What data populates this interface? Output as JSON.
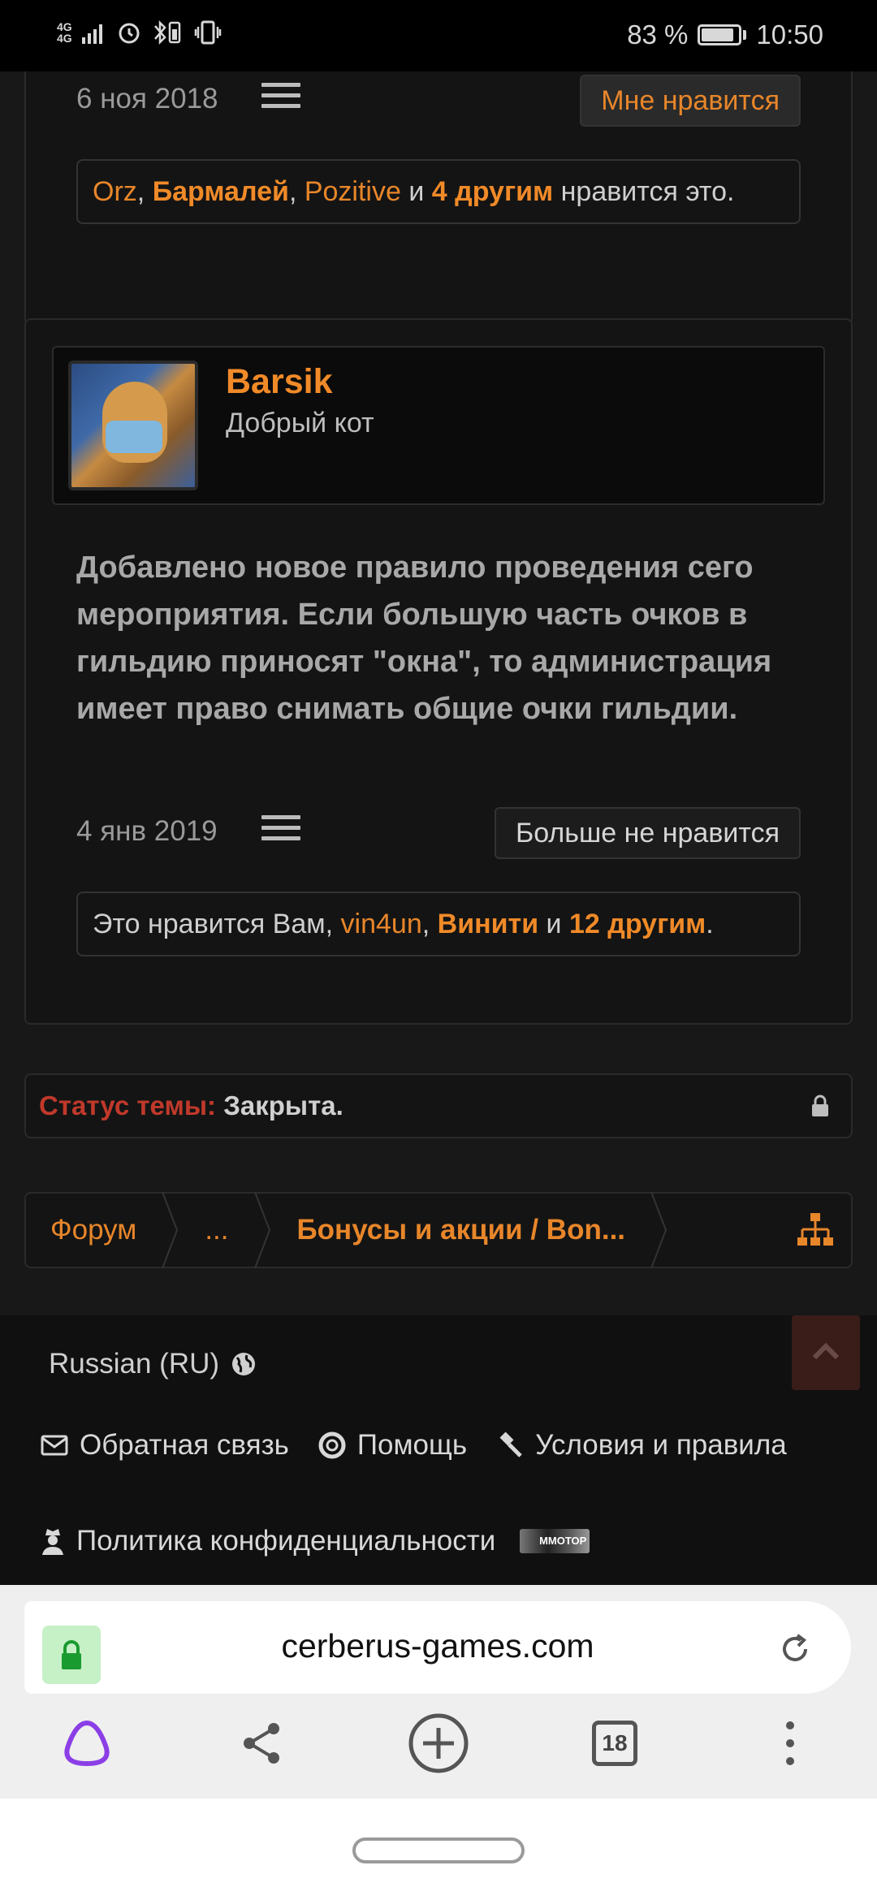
{
  "status_bar": {
    "network": "4G",
    "network_sub": "4G",
    "battery_text": "83 %",
    "battery_level": 0.83,
    "time": "10:50"
  },
  "post1": {
    "date": "6 ноя 2018",
    "like_label": "Мне нравится",
    "likes": {
      "users": [
        "Orz",
        "Бармалей",
        "Pozitive"
      ],
      "sep": ", ",
      "and": " и ",
      "others": "4 другим",
      "suffix": " нравится это."
    }
  },
  "post2": {
    "username": "Barsik",
    "user_title": "Добрый кот",
    "text": "Добавлено новое правило проведения сего мероприятия. Если большую часть очков в гильдию приносят \"окна\", то администрация имеет право снимать общие очки гильдии.",
    "date": "4 янв 2019",
    "unlike_label": "Больше не нравится",
    "likes": {
      "prefix": "Это нравится Вам, ",
      "user1": "vin4un",
      "sep": ", ",
      "user2": "Винити",
      "and": " и ",
      "others": "12 другим",
      "suffix": "."
    }
  },
  "thread_status": {
    "label": "Статус темы:",
    "value": "Закрыта."
  },
  "breadcrumb": {
    "items": [
      "Форум",
      "...",
      "Бонусы и акции / Bon..."
    ]
  },
  "footer": {
    "language": "Russian (RU)",
    "links": [
      "Обратная связь",
      "Помощь",
      "Условия и правила",
      "Политика конфиденциальности"
    ],
    "mmotop": "MMOTOP"
  },
  "browser": {
    "url": "cerberus-games.com",
    "tab_count": "18"
  },
  "colors": {
    "accent": "#e8862a",
    "status_label": "#c0392b",
    "background": "#181818"
  }
}
